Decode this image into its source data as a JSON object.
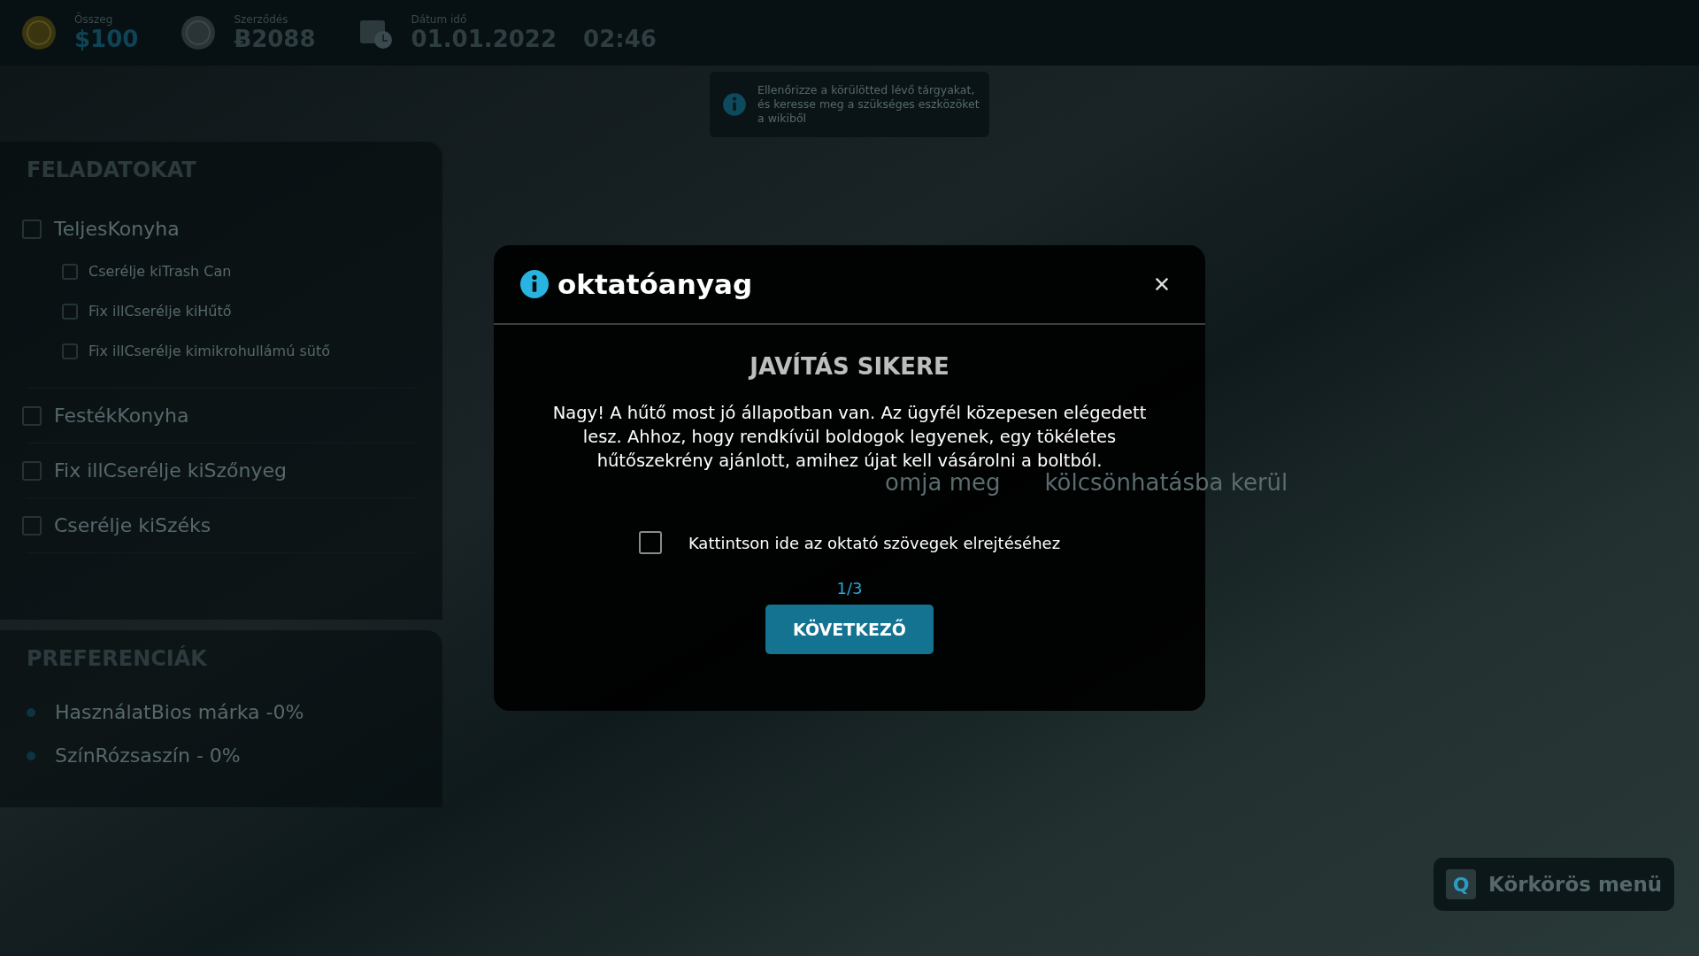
{
  "top_bar": {
    "items": [
      {
        "kind": "money",
        "label": "Összeg",
        "value": "$100"
      },
      {
        "kind": "contract",
        "label": "Szerződés",
        "value": "Ƀ2088"
      },
      {
        "kind": "date",
        "label": "Dátum idő",
        "value": "01.01.2022",
        "time": "02:46"
      }
    ]
  },
  "hint_toast": {
    "text": "Ellenőrizze a körülötted lévő tárgyakat, és keresse meg a szükséges eszközöket a wikiből"
  },
  "tasks": {
    "title": "FELADATOKAT",
    "items": [
      {
        "label": "TeljesKonyha",
        "checked": false,
        "children": [
          {
            "label": "Cserélje kiTrash Can",
            "checked": false
          },
          {
            "label": "Fix illCserélje kiHűtő",
            "checked": false
          },
          {
            "label": "Fix illCserélje kimikrohullámú sütő",
            "checked": false
          }
        ]
      },
      {
        "label": "FestékKonyha",
        "checked": false
      },
      {
        "label": "Fix illCserélje kiSzőnyeg",
        "checked": false
      },
      {
        "label": "Cserélje kiSzéks",
        "checked": false
      }
    ]
  },
  "preferences": {
    "title": "PREFERENCIÁK",
    "items": [
      {
        "label": "HasználatBios márka -0%"
      },
      {
        "label": "SzínRózsaszín - 0%"
      }
    ]
  },
  "background_hint": [
    "omja meg",
    "kölcsönhatásba kerül"
  ],
  "dialog": {
    "title": "oktatóanyag",
    "heading": "JAVÍTÁS SIKERE",
    "body": "Nagy! A hűtő most jó állapotban van. Az ügyfél közepesen elégedett lesz. Ahhoz, hogy rendkívül boldogok legyenek, egy tökéletes hűtőszekrény ajánlott, amihez újat kell vásárolni a boltból.",
    "hide_checkbox": {
      "label": "Kattintson ide az oktató szövegek elrejtéséhez",
      "checked": false
    },
    "page": "1/3",
    "next_button": "KÖVETKEZŐ"
  },
  "radial_menu": {
    "key": "Q",
    "label": "Körkörös menü"
  }
}
